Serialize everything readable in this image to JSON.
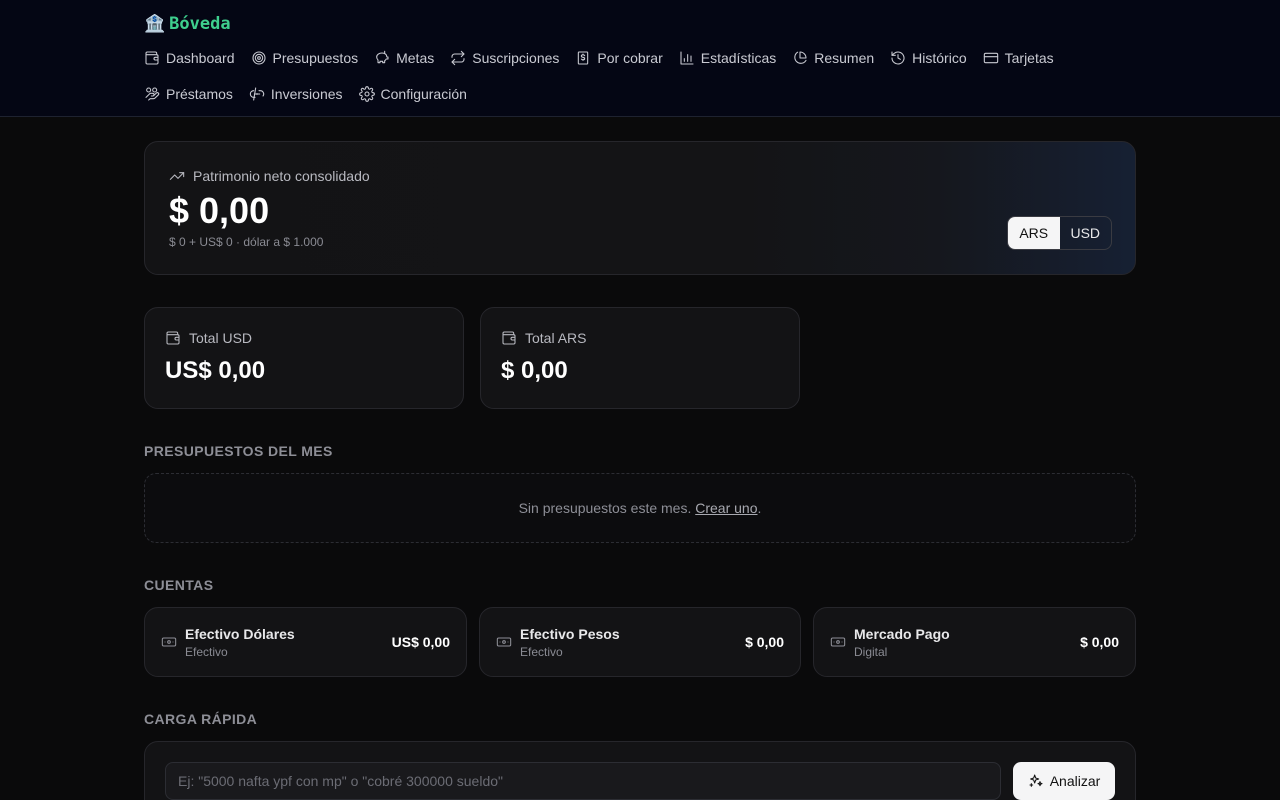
{
  "brand": {
    "icon": "bank-icon",
    "name": "Bóveda"
  },
  "nav": {
    "row1": [
      {
        "label": "Dashboard",
        "icon": "wallet-icon"
      },
      {
        "label": "Presupuestos",
        "icon": "target-icon"
      },
      {
        "label": "Metas",
        "icon": "piggy-bank-icon"
      },
      {
        "label": "Suscripciones",
        "icon": "repeat-icon"
      },
      {
        "label": "Por cobrar",
        "icon": "receipt-icon"
      },
      {
        "label": "Estadísticas",
        "icon": "bar-chart-icon"
      },
      {
        "label": "Resumen",
        "icon": "pie-chart-icon"
      },
      {
        "label": "Histórico",
        "icon": "history-icon"
      },
      {
        "label": "Tarjetas",
        "icon": "credit-card-icon"
      }
    ],
    "row2": [
      {
        "label": "Préstamos",
        "icon": "hand-coins-icon"
      },
      {
        "label": "Inversiones",
        "icon": "link-icon"
      },
      {
        "label": "Configuración",
        "icon": "gear-icon"
      }
    ]
  },
  "hero": {
    "label": "Patrimonio neto consolidado",
    "value": "$ 0,00",
    "sub": "$ 0 + US$ 0 · dólar a $ 1.000",
    "currency_options": [
      "ARS",
      "USD"
    ],
    "selected_currency": "ARS"
  },
  "stats": [
    {
      "label": "Total USD",
      "value": "US$ 0,00"
    },
    {
      "label": "Total ARS",
      "value": "$ 0,00"
    }
  ],
  "budgets": {
    "title": "Presupuestos del mes",
    "empty_text": "Sin presupuestos este mes.",
    "create_link": "Crear uno",
    "period": "."
  },
  "accounts": {
    "title": "Cuentas",
    "items": [
      {
        "name": "Efectivo Dólares",
        "type": "Efectivo",
        "balance": "US$ 0,00",
        "icon": "banknote-icon"
      },
      {
        "name": "Efectivo Pesos",
        "type": "Efectivo",
        "balance": "$ 0,00",
        "icon": "banknote-icon"
      },
      {
        "name": "Mercado Pago",
        "type": "Digital",
        "balance": "$ 0,00",
        "icon": "banknote-icon"
      }
    ]
  },
  "quick": {
    "title": "Carga rápida",
    "placeholder": "Ej: \"5000 nafta ypf con mp\" o \"cobré 300000 sueldo\"",
    "value": "",
    "button": "Analizar",
    "button_icon": "sparkles-icon"
  },
  "colors": {
    "background": "#0a0a0b",
    "header": "#040614",
    "card": "#131315",
    "brand": "#3ecf8e"
  }
}
